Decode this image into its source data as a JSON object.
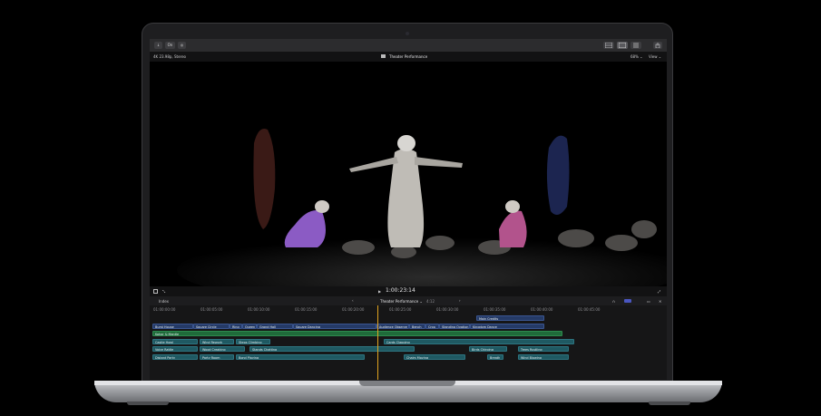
{
  "toolbar": {
    "left_buttons": [
      "↓",
      "On",
      "◎"
    ],
    "right_icons": [
      "grid-icon",
      "film-icon",
      "sliders-icon",
      "share-icon"
    ]
  },
  "infobar": {
    "format": "4K 23.98p, Stereo",
    "project_title": "Theater Performance",
    "zoom": "68%",
    "zoom_chevron": "⌄",
    "view_label": "View",
    "view_chevron": "⌄"
  },
  "transport": {
    "play_symbol": "▶",
    "timecode": "1:00:23:14"
  },
  "timeline_header": {
    "index_label": "Index",
    "project_name": "Theater Performance",
    "project_chevron": "⌄",
    "duration": "4:12"
  },
  "ruler_ticks": [
    "01:00:00:00",
    "01:00:05:00",
    "01:00:10:00",
    "01:00:15:00",
    "01:00:20:00",
    "01:00:25:00",
    "01:00:30:00",
    "01:00:35:00",
    "01:00:40:00",
    "01:00:45:00"
  ],
  "clips": {
    "titles": [
      {
        "label": "Main Credits"
      }
    ],
    "video_row": [
      {
        "label": "Burst House"
      },
      {
        "label": "Square Circle"
      },
      {
        "label": "Ring"
      },
      {
        "label": "Queen"
      },
      {
        "label": "Grand Hall"
      },
      {
        "label": "Square Dancing"
      },
      {
        "label": "Audience Observe"
      },
      {
        "label": "Bench"
      },
      {
        "label": "Crop"
      },
      {
        "label": "Standing Ovation"
      },
      {
        "label": "Kingdom Dance"
      }
    ],
    "music_row": [
      {
        "label": "Kohar & Mantle"
      }
    ],
    "audio_row_1": [
      {
        "label": "Castle Howl"
      },
      {
        "label": "Wind Rework"
      },
      {
        "label": "Steps Climbing"
      },
      {
        "label": "Cards Clapping"
      },
      {
        "label": "Birds Chirping"
      },
      {
        "label": "Trees Rustling"
      }
    ],
    "audio_row_2": [
      {
        "label": "Voice Rattle"
      },
      {
        "label": "Wood Creaking"
      },
      {
        "label": "Stands Chatting"
      },
      {
        "label": "Birds Chirping"
      },
      {
        "label": "Trees Rustling"
      }
    ],
    "audio_row_3": [
      {
        "label": "Distant Party"
      },
      {
        "label": "Party Room"
      },
      {
        "label": "Bond Playing"
      },
      {
        "label": "Chairs Moving"
      },
      {
        "label": "Breath"
      },
      {
        "label": "Wind Blowing"
      }
    ]
  }
}
